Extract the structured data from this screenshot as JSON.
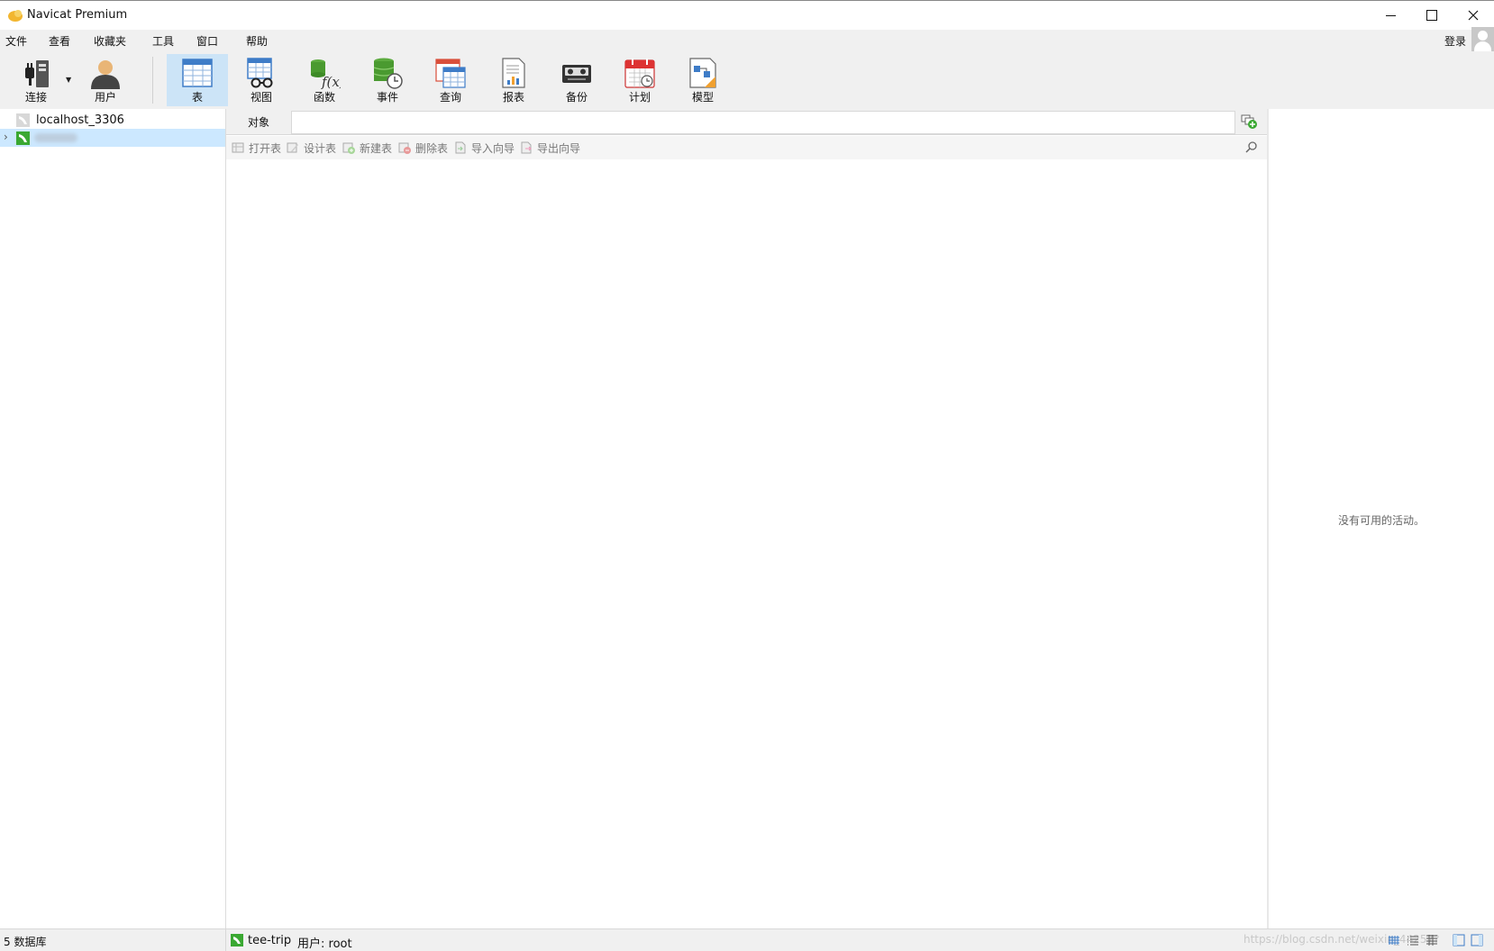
{
  "window": {
    "title": "Navicat Premium",
    "minimize_label": "Minimize",
    "maximize_label": "Maximize",
    "close_label": "Close"
  },
  "menubar": {
    "items": [
      "文件",
      "查看",
      "收藏夹",
      "工具",
      "窗口",
      "帮助"
    ],
    "login_label": "登录"
  },
  "toolbar": {
    "buttons": [
      {
        "label": "连接",
        "icon": "plug-icon"
      },
      {
        "label": "用户",
        "icon": "user-icon"
      },
      {
        "label": "表",
        "icon": "table-icon",
        "active": true
      },
      {
        "label": "视图",
        "icon": "view-icon"
      },
      {
        "label": "函数",
        "icon": "function-icon"
      },
      {
        "label": "事件",
        "icon": "event-icon"
      },
      {
        "label": "查询",
        "icon": "query-icon"
      },
      {
        "label": "报表",
        "icon": "report-icon"
      },
      {
        "label": "备份",
        "icon": "backup-icon"
      },
      {
        "label": "计划",
        "icon": "schedule-icon"
      },
      {
        "label": "模型",
        "icon": "model-icon"
      }
    ]
  },
  "sidebar": {
    "connections": [
      {
        "name": "localhost_3306",
        "status": "disconnected"
      },
      {
        "name": "",
        "status": "connected",
        "selected": true,
        "blurred": true
      }
    ]
  },
  "main": {
    "tab_label": "对象",
    "object_toolbar": [
      "打开表",
      "设计表",
      "新建表",
      "删除表",
      "导入向导",
      "导出向导"
    ]
  },
  "right_panel": {
    "empty_text": "没有可用的活动。"
  },
  "statusbar": {
    "db_count": "5 数据库",
    "current_db": "tee-trip",
    "user": "用户: root",
    "watermark": "https://blog.csdn.net/weixin_44257?"
  },
  "colors": {
    "active_button_bg": "#cce4f7",
    "selected_row_bg": "#cce8ff",
    "connection_green": "#3aa832"
  }
}
